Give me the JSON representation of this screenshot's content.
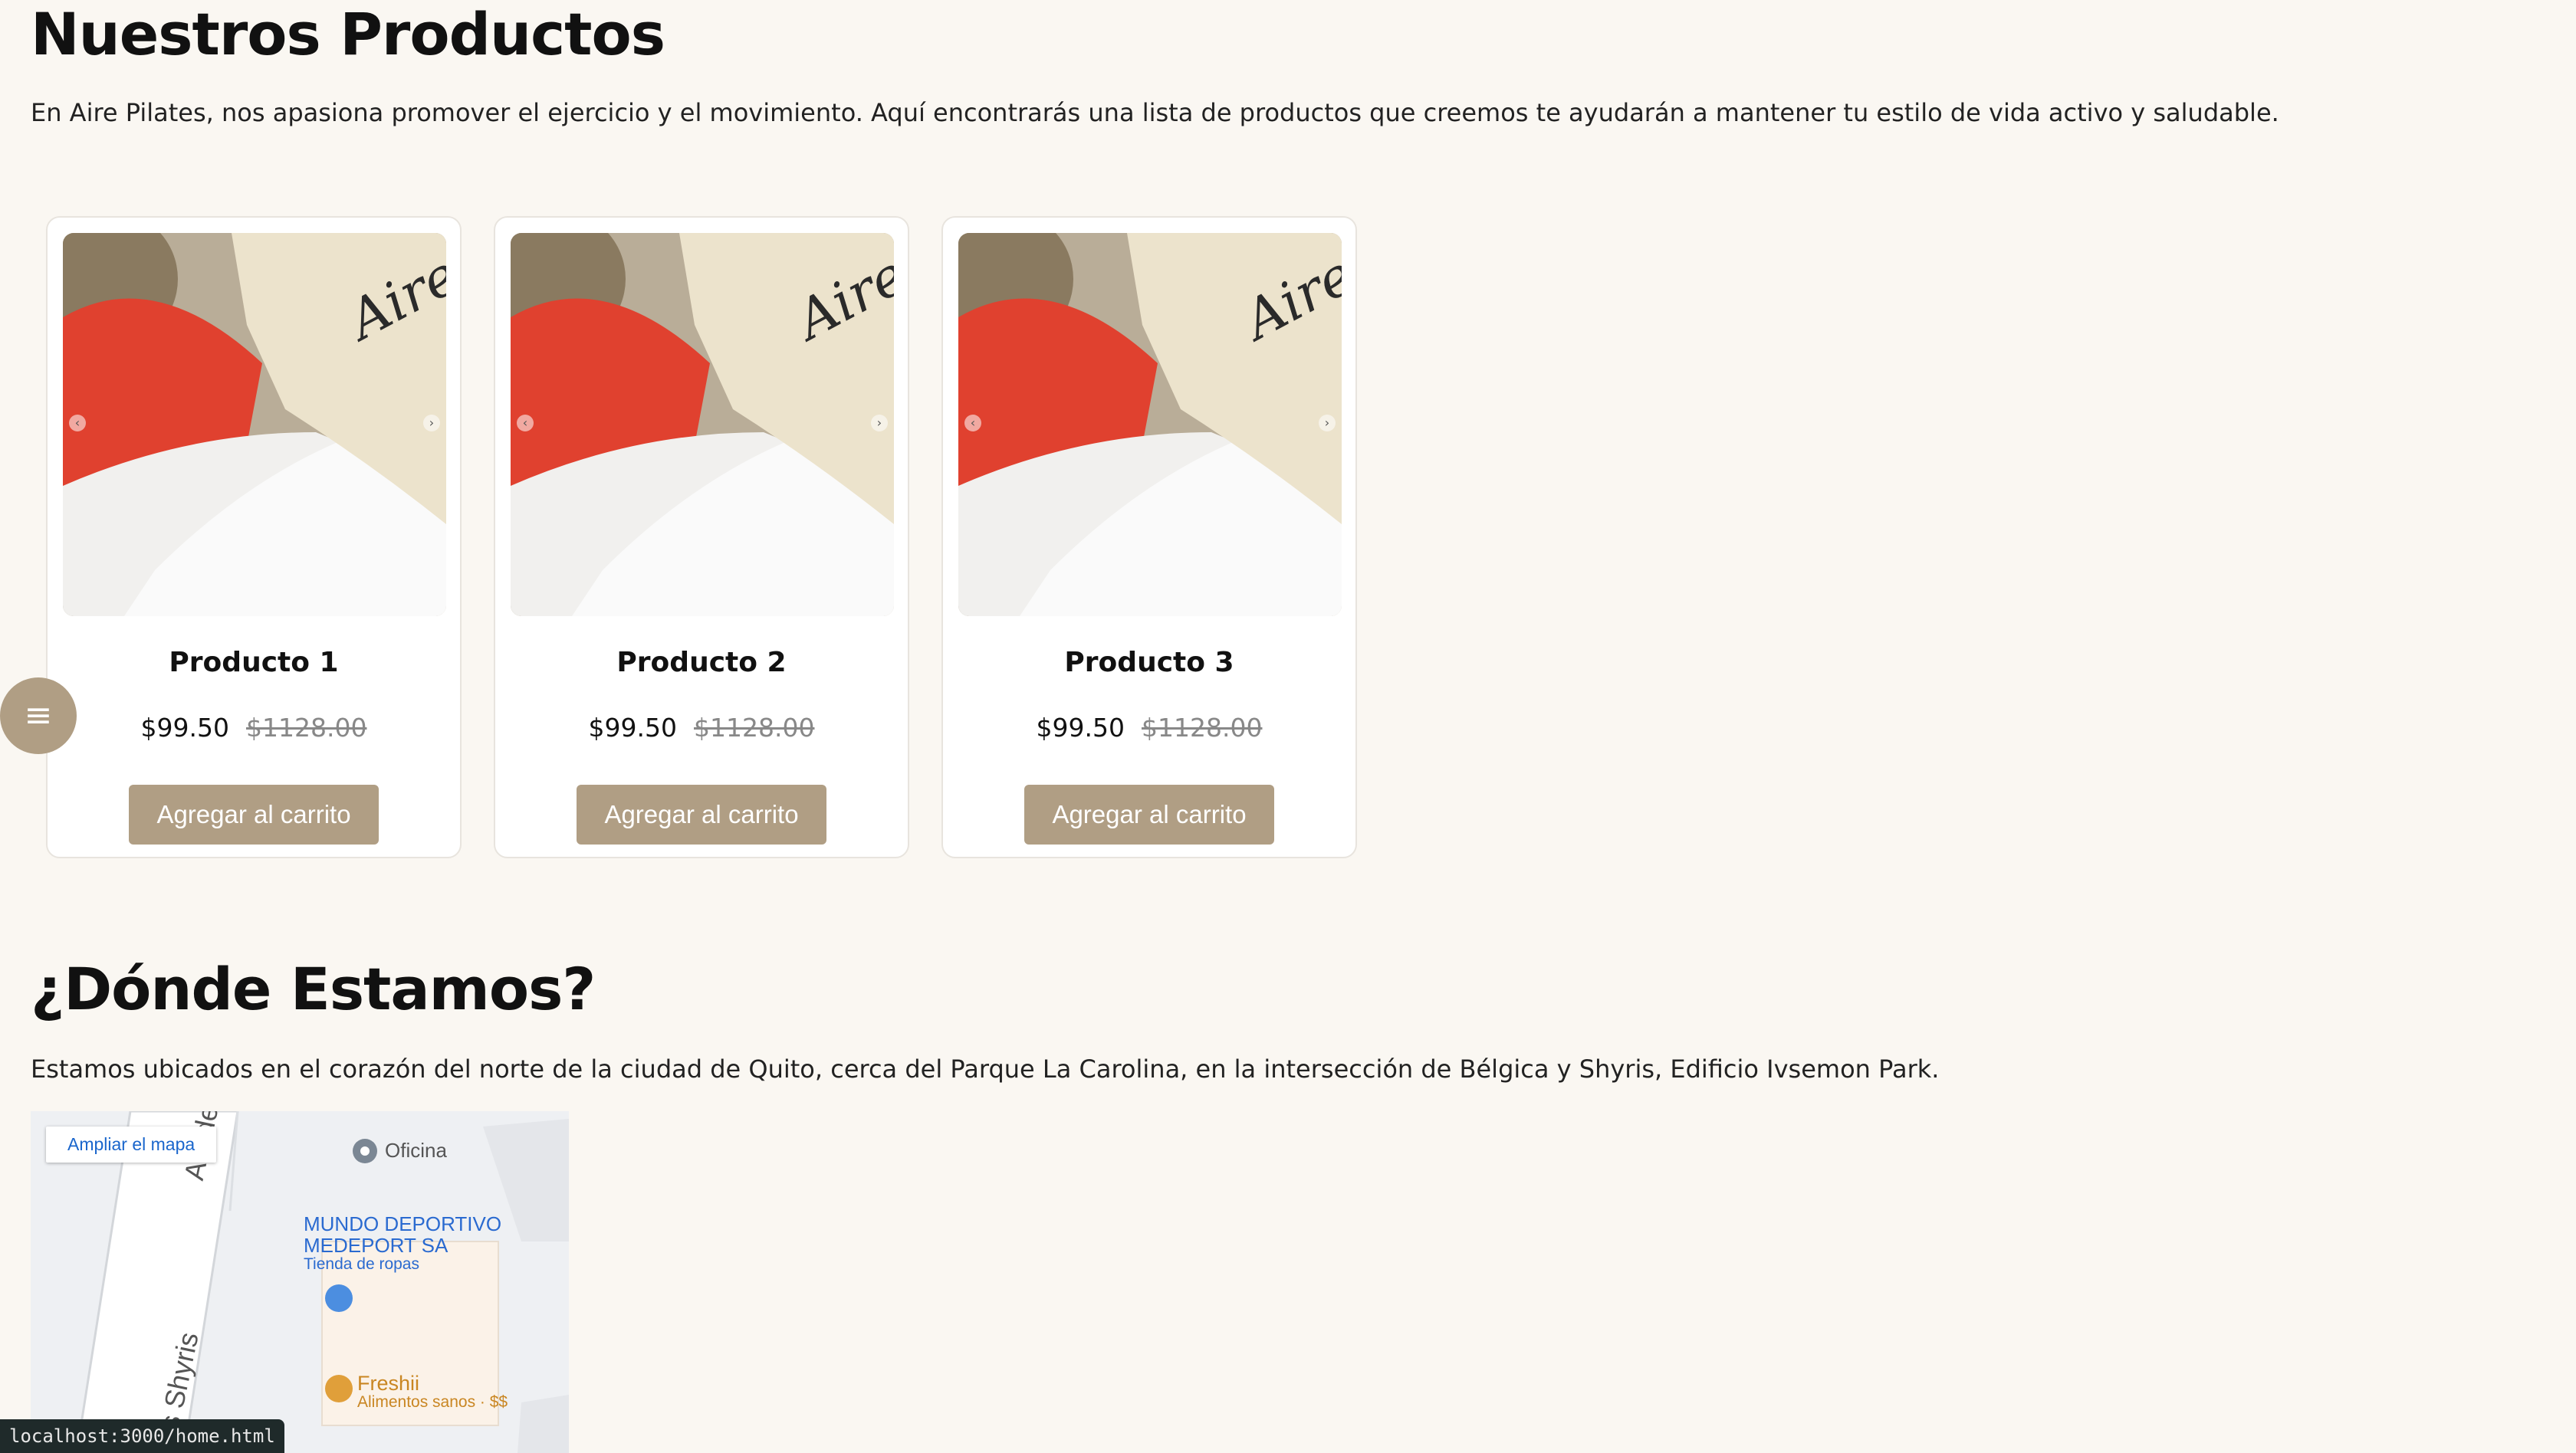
{
  "products_section": {
    "title": "Nuestros Productos",
    "intro": "En Aire Pilates, nos apasiona promover el ejercicio y el movimiento. Aquí encontrarás una lista de productos que creemos te ayudarán a mantener tu estilo de vida activo y saludable."
  },
  "products": [
    {
      "name": "Producto 1",
      "price": "$99.50",
      "old_price": "$1128.00",
      "button": "Agregar al carrito",
      "image_icon": "product-photo-bag-aire"
    },
    {
      "name": "Producto 2",
      "price": "$99.50",
      "old_price": "$1128.00",
      "button": "Agregar al carrito",
      "image_icon": "product-photo-bag-aire"
    },
    {
      "name": "Producto 3",
      "price": "$99.50",
      "old_price": "$1128.00",
      "button": "Agregar al carrito",
      "image_icon": "product-photo-bag-aire"
    }
  ],
  "carousel": {
    "prev_icon": "chevron-left-icon",
    "next_icon": "chevron-right-icon"
  },
  "menu_button": {
    "icon": "hamburger-menu-icon"
  },
  "location_section": {
    "title": "¿Dónde Estamos?",
    "description": "Estamos ubicados en el corazón del norte de la ciudad de Quito, cerca del Parque La Carolina, en la intersección de Bélgica y Shyris, Edificio Ivsemon Park."
  },
  "map": {
    "expand_link": "Ampliar el mapa",
    "street_1": "Av. de los",
    "street_2": "s Shyris",
    "poi_office": "Oficina",
    "poi_store_name_line1": "MUNDO DEPORTIVO",
    "poi_store_name_line2": "MEDEPORT SA",
    "poi_store_type": "Tienda de ropas",
    "poi_food_name": "Freshii",
    "poi_food_type": "Alimentos sanos · $$"
  },
  "status_bar": {
    "url": "localhost:3000/home.html"
  },
  "colors": {
    "accent": "#b09e84",
    "background": "#faf7f2",
    "card_border": "#e8e4de"
  }
}
